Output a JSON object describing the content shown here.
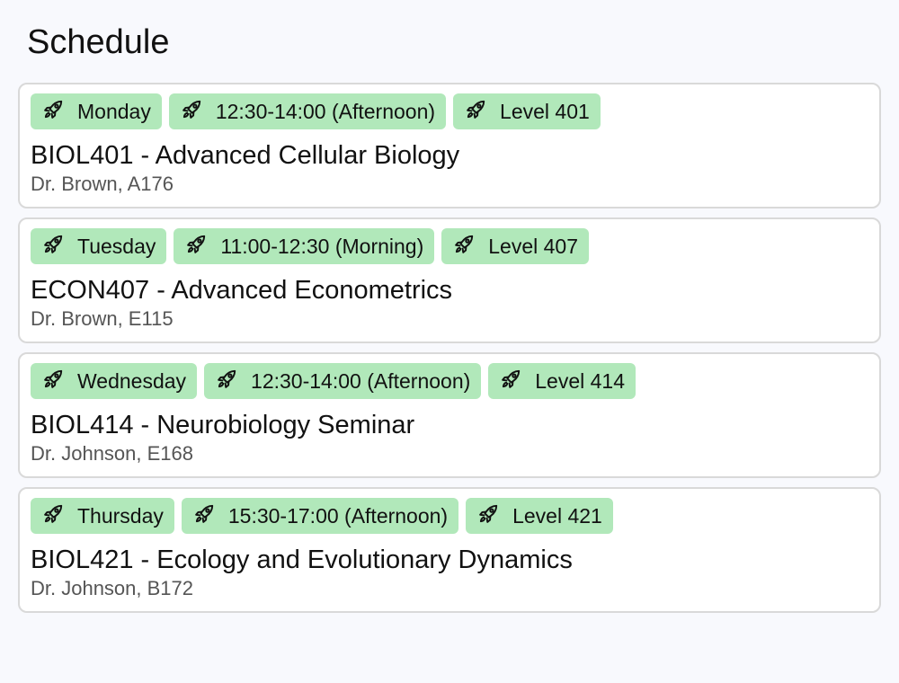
{
  "page": {
    "title": "Schedule"
  },
  "colors": {
    "background": "#f8f9fd",
    "tag_background": "#b1e8ba",
    "card_border": "#d9d9d9",
    "meta_text": "#555555"
  },
  "tag_icon": "rocket-icon",
  "courses": [
    {
      "day": "Monday",
      "time": "12:30-14:00 (Afternoon)",
      "level": "Level 401",
      "title": "BIOL401 - Advanced Cellular Biology",
      "meta": "Dr. Brown, A176"
    },
    {
      "day": "Tuesday",
      "time": "11:00-12:30 (Morning)",
      "level": "Level 407",
      "title": "ECON407 - Advanced Econometrics",
      "meta": "Dr. Brown, E115"
    },
    {
      "day": "Wednesday",
      "time": "12:30-14:00 (Afternoon)",
      "level": "Level 414",
      "title": "BIOL414 - Neurobiology Seminar",
      "meta": "Dr. Johnson, E168"
    },
    {
      "day": "Thursday",
      "time": "15:30-17:00 (Afternoon)",
      "level": "Level 421",
      "title": "BIOL421 - Ecology and Evolutionary Dynamics",
      "meta": "Dr. Johnson, B172"
    }
  ]
}
